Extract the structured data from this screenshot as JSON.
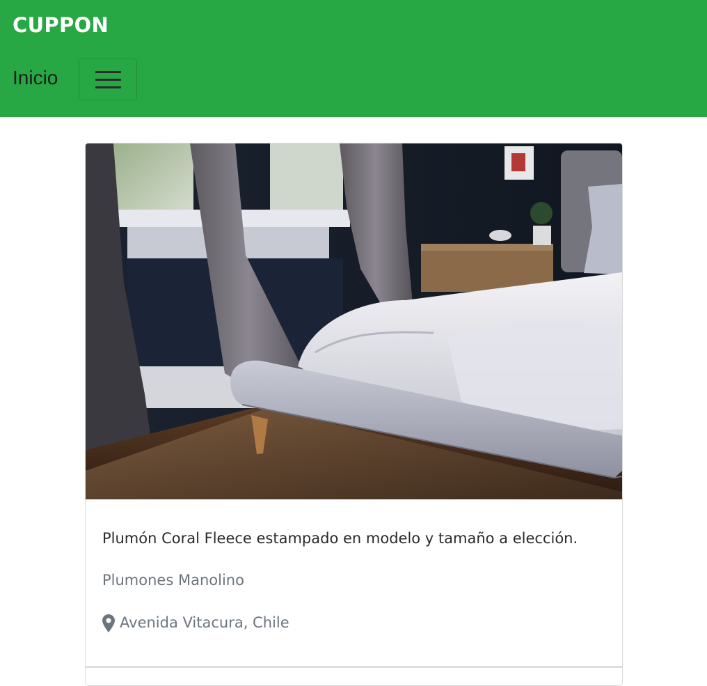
{
  "navbar": {
    "brand": "CUPPON",
    "nav_link": "Inicio",
    "toggler_icon": "hamburger-menu-icon",
    "background": "#28a745"
  },
  "card": {
    "image_alt": "Cama con plumón blanco junto a ventana con cortinas",
    "title": "Plumón Coral Fleece estampado en modelo y tamaño a elección.",
    "store": "Plumones Manolino",
    "location_icon": "map-marker-icon",
    "location": "Avenida Vitacura, Chile"
  }
}
